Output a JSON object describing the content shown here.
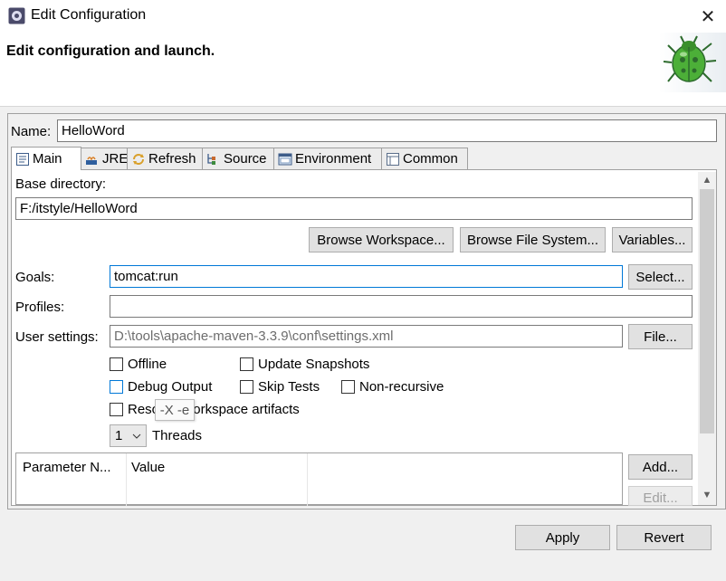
{
  "window": {
    "title": "Edit Configuration",
    "header_title": "Edit configuration and launch.",
    "icons": {
      "app": "eclipse-config-icon",
      "close": "close-icon",
      "banner": "bug-icon"
    }
  },
  "name_field": {
    "label": "Name:",
    "value": "HelloWord"
  },
  "tabs": [
    {
      "label": "Main",
      "icon": "main-tab-icon",
      "active": true
    },
    {
      "label": "JRE",
      "icon": "jre-icon"
    },
    {
      "label": "Refresh",
      "icon": "refresh-icon"
    },
    {
      "label": "Source",
      "icon": "source-icon"
    },
    {
      "label": "Environment",
      "icon": "environment-icon"
    },
    {
      "label": "Common",
      "icon": "common-icon"
    }
  ],
  "main": {
    "base_directory": {
      "label": "Base directory:",
      "value": "F:/itstyle/HelloWord"
    },
    "buttons": {
      "browse_workspace": "Browse Workspace...",
      "browse_file_system": "Browse File System...",
      "variables": "Variables...",
      "select": "Select...",
      "file": "File...",
      "add": "Add...",
      "edit": "Edit..."
    },
    "goals": {
      "label": "Goals:",
      "value": "tomcat:run"
    },
    "profiles": {
      "label": "Profiles:",
      "value": ""
    },
    "user_settings": {
      "label": "User settings:",
      "value": "D:\\tools\\apache-maven-3.3.9\\conf\\settings.xml"
    },
    "checkboxes": {
      "offline": {
        "label": "Offline",
        "checked": false
      },
      "update_snapshots": {
        "label": "Update Snapshots",
        "checked": false
      },
      "debug_output": {
        "label": "Debug Output",
        "checked": false
      },
      "skip_tests": {
        "label": "Skip Tests",
        "checked": false
      },
      "non_recursive": {
        "label": "Non-recursive",
        "checked": false
      },
      "resolve_workspace": {
        "label": "Resolve Workspace artifacts",
        "checked": false
      }
    },
    "threads": {
      "value": "1",
      "label": "Threads"
    },
    "tooltip": "-X -e",
    "params_table": {
      "columns": [
        "Parameter N...",
        "Value"
      ],
      "rows": []
    }
  },
  "footer": {
    "apply": "Apply",
    "revert": "Revert"
  },
  "colors": {
    "focus_border": "#0078d7",
    "button_bg": "#e1e1e1",
    "dialog_bg": "#f0f0f0"
  }
}
